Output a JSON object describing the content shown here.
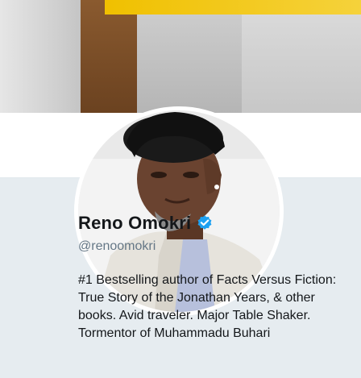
{
  "profile": {
    "display_name": "Reno Omokri",
    "handle": "@renoomokri",
    "bio": "#1 Bestselling author of Facts Versus Fiction: True Story of the Jonathan Years, & other books. Avid traveler. Major Table Shaker. Tormentor of Muhammadu Buhari",
    "verified": true,
    "verified_icon": "verified-badge-icon",
    "accent_color": "#1da1f2"
  }
}
